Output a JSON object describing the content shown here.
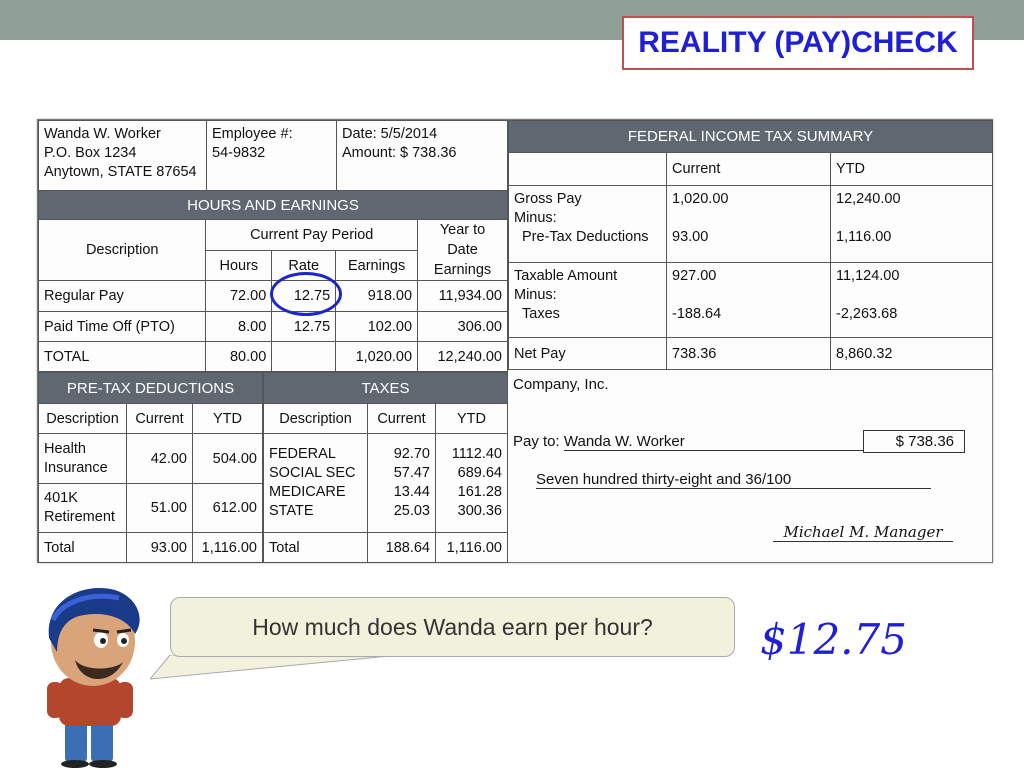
{
  "slide": {
    "title": "REALITY (PAY)CHECK",
    "question": "How much does Wanda earn per hour?",
    "answer": "$12.75"
  },
  "employee": {
    "name": "Wanda W. Worker",
    "address1": "P.O. Box 1234",
    "address2": "Anytown, STATE 87654",
    "employee_label": "Employee #:",
    "employee_number": "54-9832",
    "date": "Date: 5/5/2014",
    "amount": "Amount: $ 738.36"
  },
  "hours_earnings": {
    "header": "HOURS AND EARNINGS",
    "col_description": "Description",
    "col_current_period": "Current Pay Period",
    "col_hours": "Hours",
    "col_rate": "Rate",
    "col_earnings": "Earnings",
    "col_ytd_line1": "Year to Date",
    "col_ytd_line2": "Earnings",
    "rows": [
      {
        "desc": "Regular Pay",
        "hours": "72.00",
        "rate": "12.75",
        "earnings": "918.00",
        "ytd": "11,934.00"
      },
      {
        "desc": "Paid Time Off (PTO)",
        "hours": "8.00",
        "rate": "12.75",
        "earnings": "102.00",
        "ytd": "306.00"
      },
      {
        "desc": "TOTAL",
        "hours": "80.00",
        "rate": "",
        "earnings": "1,020.00",
        "ytd": "12,240.00"
      }
    ]
  },
  "pretax": {
    "header": "PRE-TAX DEDUCTIONS",
    "col_description": "Description",
    "col_current": "Current",
    "col_ytd": "YTD",
    "rows": [
      {
        "desc1": "Health",
        "desc2": "Insurance",
        "current": "42.00",
        "ytd": "504.00"
      },
      {
        "desc1": "401K",
        "desc2": "Retirement",
        "current": "51.00",
        "ytd": "612.00"
      }
    ],
    "total": {
      "desc": "Total",
      "current": "93.00",
      "ytd": "1,116.00"
    }
  },
  "taxes": {
    "header": "TAXES",
    "col_description": "Description",
    "col_current": "Current",
    "col_ytd": "YTD",
    "rows": [
      {
        "desc": "FEDERAL",
        "current": "92.70",
        "ytd": "1112.40"
      },
      {
        "desc": "SOCIAL SEC",
        "current": "57.47",
        "ytd": "689.64"
      },
      {
        "desc": "MEDICARE",
        "current": "13.44",
        "ytd": "161.28"
      },
      {
        "desc": "STATE",
        "current": "25.03",
        "ytd": "300.36"
      }
    ],
    "total": {
      "desc": "Total",
      "current": "188.64",
      "ytd": "1,116.00"
    }
  },
  "federal_summary": {
    "header": "FEDERAL INCOME TAX SUMMARY",
    "col_current": "Current",
    "col_ytd": "YTD",
    "gross_label": "Gross Pay",
    "minus_label": "Minus:",
    "pretax_label": "Pre-Tax Deductions",
    "gross_current": "1,020.00",
    "gross_ytd": "12,240.00",
    "pretax_current": "93.00",
    "pretax_ytd": "1,116.00",
    "taxable_label": "Taxable Amount",
    "taxes_label": "Taxes",
    "taxable_current": "927.00",
    "taxable_ytd": "11,124.00",
    "taxes_current": "-188.64",
    "taxes_ytd": "-2,263.68",
    "net_label": "Net Pay",
    "net_current": "738.36",
    "net_ytd": "8,860.32"
  },
  "check": {
    "company": "Company, Inc.",
    "payto_label": "Pay to:",
    "payto_name": "Wanda W. Worker",
    "amount": "$ 738.36",
    "amount_words": "Seven hundred thirty-eight and 36/100",
    "signature": "Michael M. Manager"
  }
}
